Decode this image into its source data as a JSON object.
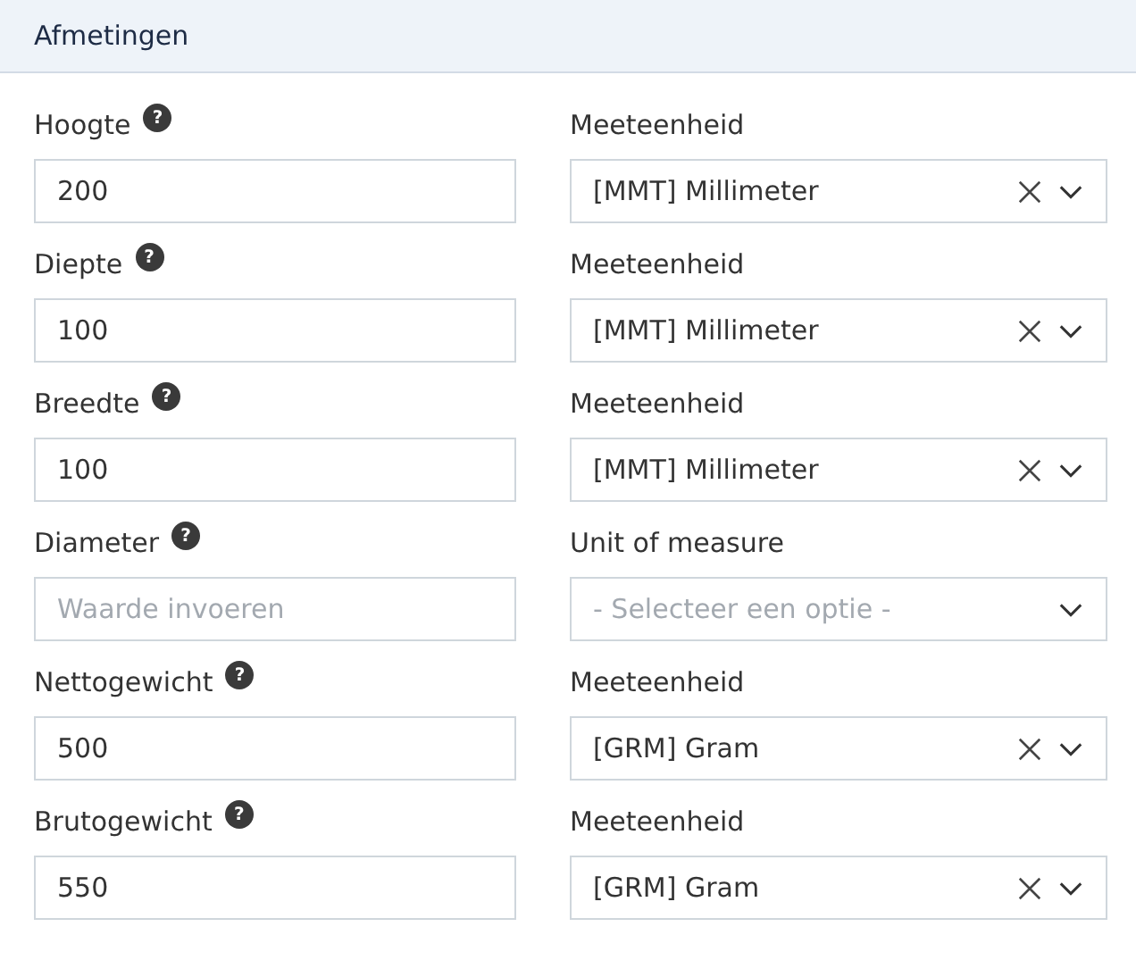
{
  "section": {
    "title": "Afmetingen"
  },
  "rows": [
    {
      "label": "Hoogte",
      "help": "?",
      "input": {
        "value": "200"
      },
      "unit_label": "Meeteenheid",
      "unit": {
        "value": "[MMT] Millimeter"
      }
    },
    {
      "label": "Diepte",
      "help": "?",
      "input": {
        "value": "100"
      },
      "unit_label": "Meeteenheid",
      "unit": {
        "value": "[MMT] Millimeter"
      }
    },
    {
      "label": "Breedte",
      "help": "?",
      "input": {
        "value": "100"
      },
      "unit_label": "Meeteenheid",
      "unit": {
        "value": "[MMT] Millimeter"
      }
    },
    {
      "label": "Diameter",
      "help": "?",
      "input": {
        "placeholder": "Waarde invoeren"
      },
      "unit_label": "Unit of measure",
      "unit": {
        "placeholder": "- Selecteer een optie -"
      }
    },
    {
      "label": "Nettogewicht",
      "help": "?",
      "input": {
        "value": "500"
      },
      "unit_label": "Meeteenheid",
      "unit": {
        "value": "[GRM] Gram"
      }
    },
    {
      "label": "Brutogewicht",
      "help": "?",
      "input": {
        "value": "550"
      },
      "unit_label": "Meeteenheid",
      "unit": {
        "value": "[GRM] Gram"
      }
    }
  ]
}
